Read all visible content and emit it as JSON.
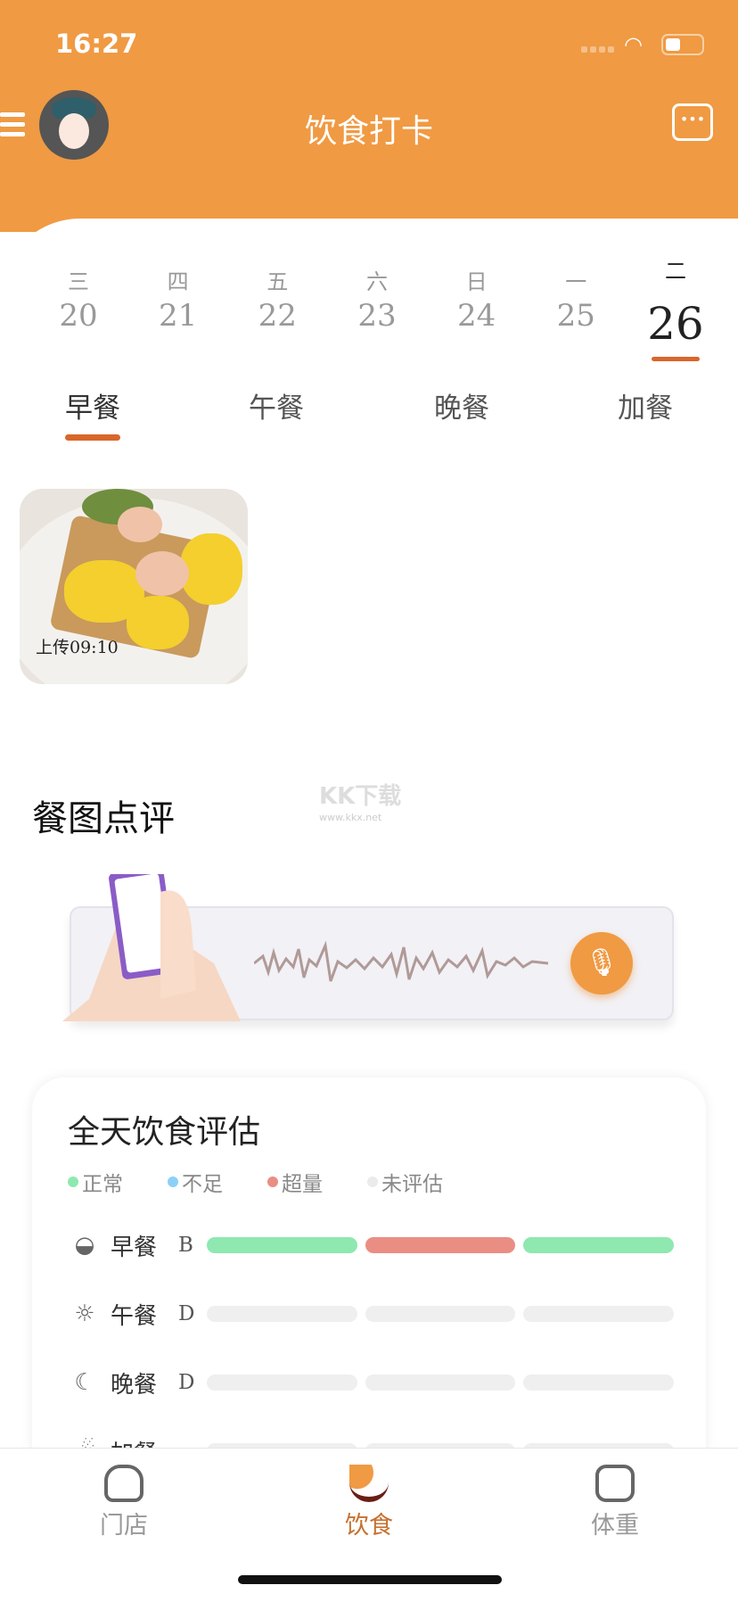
{
  "status_bar": {
    "time": "16:27"
  },
  "header": {
    "title": "饮食打卡",
    "menu_icon": "hamburger-icon",
    "calendar_icon": "calendar-icon"
  },
  "week": [
    {
      "weekday": "三",
      "date": "20"
    },
    {
      "weekday": "四",
      "date": "21"
    },
    {
      "weekday": "五",
      "date": "22"
    },
    {
      "weekday": "六",
      "date": "23"
    },
    {
      "weekday": "日",
      "date": "24"
    },
    {
      "weekday": "一",
      "date": "25"
    },
    {
      "weekday": "二",
      "date": "26",
      "selected": true
    }
  ],
  "meal_tabs": [
    {
      "label": "早餐",
      "selected": true
    },
    {
      "label": "午餐"
    },
    {
      "label": "晚餐"
    },
    {
      "label": "加餐"
    }
  ],
  "photos": [
    {
      "caption": "上传09:10"
    }
  ],
  "review": {
    "title": "餐图点评"
  },
  "watermark": {
    "text": "KK下载",
    "url": "www.kkx.net"
  },
  "evaluation": {
    "title": "全天饮食评估",
    "legend": [
      {
        "label": "正常",
        "color": "#8EE8B0"
      },
      {
        "label": "不足",
        "color": "#8DD0F5"
      },
      {
        "label": "超量",
        "color": "#EA8E84"
      },
      {
        "label": "未评估",
        "color": "#EBEBEB"
      }
    ],
    "rows": [
      {
        "icon": "sunrise-icon",
        "meal": "早餐",
        "grade": "B",
        "status": [
          "正常",
          "超量",
          "正常"
        ]
      },
      {
        "icon": "sun-icon",
        "meal": "午餐",
        "grade": "D",
        "status": [
          "未评估",
          "未评估",
          "未评估"
        ]
      },
      {
        "icon": "moon-icon",
        "meal": "晚餐",
        "grade": "D",
        "status": [
          "未评估",
          "未评估",
          "未评估"
        ]
      },
      {
        "icon": "snack-icon",
        "meal": "加餐",
        "grade": "",
        "status": [
          "未评估",
          "未评估",
          "未评估"
        ]
      }
    ]
  },
  "bottom_nav": [
    {
      "label": "门店",
      "icon": "store-icon"
    },
    {
      "label": "饮食",
      "icon": "bowl-icon",
      "selected": true
    },
    {
      "label": "体重",
      "icon": "scale-icon"
    }
  ],
  "colors": {
    "brand": "#F09A43",
    "accent": "#D9662A"
  }
}
